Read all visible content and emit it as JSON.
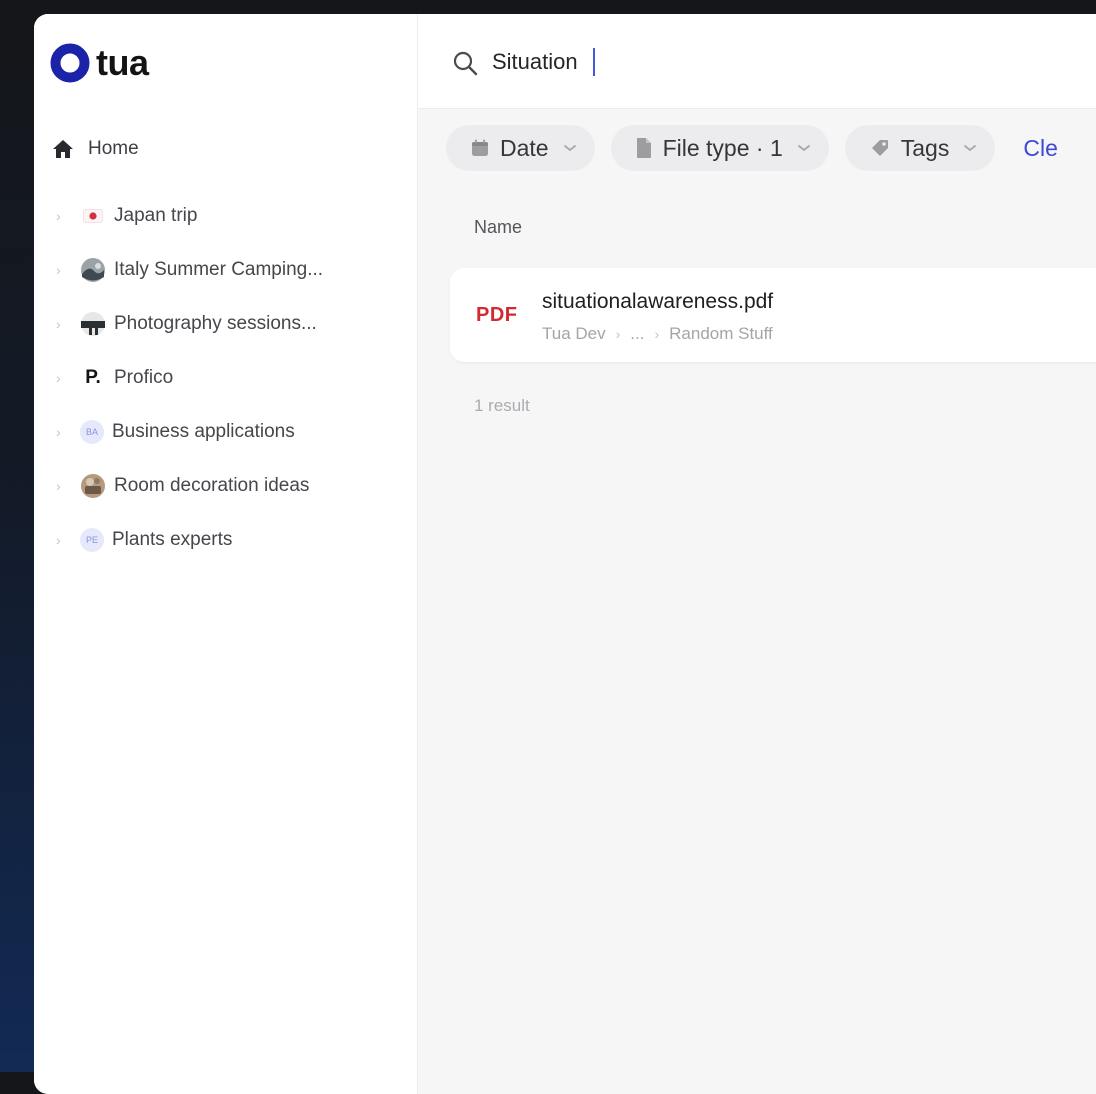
{
  "app": {
    "logo_text": "tua",
    "accent_color": "#1b24a8"
  },
  "sidebar": {
    "home_label": "Home",
    "items": [
      {
        "label": "Japan trip",
        "icon": "japan-flag-icon"
      },
      {
        "label": "Italy Summer Camping...",
        "icon": "photo-thumbnail-icon"
      },
      {
        "label": "Photography sessions...",
        "icon": "photo-thumbnail-icon"
      },
      {
        "label": "Profico",
        "icon": "profico-logo-icon",
        "icon_text": "P."
      },
      {
        "label": "Business applications",
        "icon": "initials-avatar-icon",
        "icon_text": "BA"
      },
      {
        "label": "Room decoration ideas",
        "icon": "photo-thumbnail-icon"
      },
      {
        "label": "Plants experts",
        "icon": "initials-avatar-icon",
        "icon_text": "PE"
      }
    ]
  },
  "search": {
    "value": "Situation"
  },
  "filters": {
    "date": {
      "label": "Date",
      "icon": "calendar-icon"
    },
    "file_type": {
      "label": "File type · 1",
      "icon": "file-icon"
    },
    "tags": {
      "label": "Tags",
      "icon": "tag-icon"
    },
    "clear_label": "Cle"
  },
  "results": {
    "column_name": "Name",
    "items": [
      {
        "type_badge": "PDF",
        "name": "situationalawareness.pdf",
        "path_start": "Tua Dev",
        "path_middle": "...",
        "path_end": "Random Stuff"
      }
    ],
    "count_text": "1 result"
  }
}
